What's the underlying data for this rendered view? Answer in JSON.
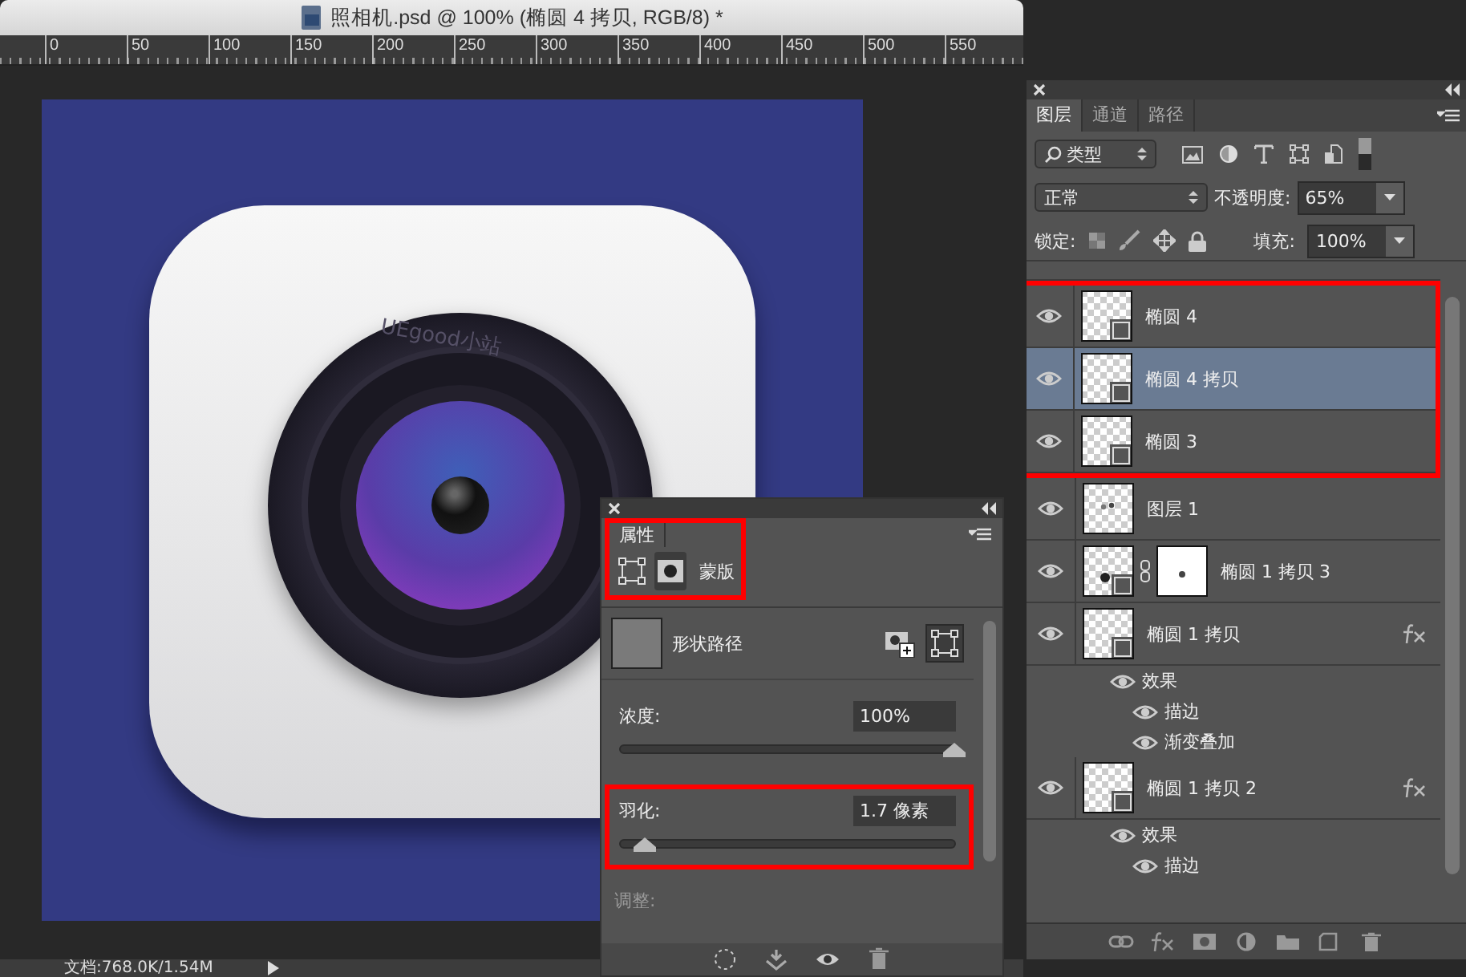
{
  "document": {
    "title": "照相机.psd @ 100% (椭圆 4 拷贝, RGB/8) *",
    "ruler_labels": [
      "0",
      "50",
      "100",
      "150",
      "200",
      "250",
      "300",
      "350",
      "400",
      "450",
      "500",
      "550"
    ],
    "lens_text": "UEgood小站",
    "status": "文档:768.0K/1.54M"
  },
  "layers_panel": {
    "tabs": [
      {
        "label": "图层",
        "selected": true
      },
      {
        "label": "通道",
        "selected": false
      },
      {
        "label": "路径",
        "selected": false
      }
    ],
    "filter": "类型",
    "blend_mode": "正常",
    "opacity_label": "不透明度:",
    "opacity": "65%",
    "lock_label": "锁定:",
    "fill_label": "填充:",
    "fill": "100%",
    "layers": [
      {
        "name": "椭圆 4",
        "kind": "shape",
        "visible": true,
        "selected": false,
        "highlighted": true
      },
      {
        "name": "椭圆 4 拷贝",
        "kind": "shape",
        "visible": true,
        "selected": true,
        "highlighted": true
      },
      {
        "name": "椭圆 3",
        "kind": "shape",
        "visible": true,
        "selected": false,
        "highlighted": true
      },
      {
        "name": "图层 1",
        "kind": "pixel",
        "visible": true,
        "selected": false,
        "highlighted": false
      },
      {
        "name": "椭圆 1 拷贝 3",
        "kind": "masked",
        "visible": true,
        "selected": false,
        "highlighted": false
      },
      {
        "name": "椭圆 1 拷贝",
        "kind": "shape",
        "visible": true,
        "selected": false,
        "highlighted": false,
        "fx": true,
        "effects": [
          {
            "label": "效果",
            "visible": true,
            "children": [
              {
                "label": "描边",
                "visible": true
              },
              {
                "label": "渐变叠加",
                "visible": true
              }
            ]
          }
        ]
      },
      {
        "name": "椭圆 1 拷贝 2",
        "kind": "shape",
        "visible": true,
        "selected": false,
        "highlighted": false,
        "fx": true,
        "effects": [
          {
            "label": "效果",
            "visible": true,
            "children": [
              {
                "label": "描边",
                "visible": true
              }
            ]
          }
        ]
      }
    ]
  },
  "properties": {
    "title": "属性",
    "highlighted": true,
    "modes": [
      {
        "kind": "vector",
        "selected": false
      },
      {
        "kind": "mask",
        "selected": true
      }
    ],
    "mode_label": "蒙版",
    "item_label": "形状路径",
    "density_label": "浓度:",
    "density": "100%",
    "density_slider": {
      "level": 1
    },
    "feather_label": "羽化:",
    "feather": "1.7 像素",
    "feather_slider": {
      "level": 0.07
    },
    "feather_highlighted": true,
    "adjust_label": "调整:"
  }
}
